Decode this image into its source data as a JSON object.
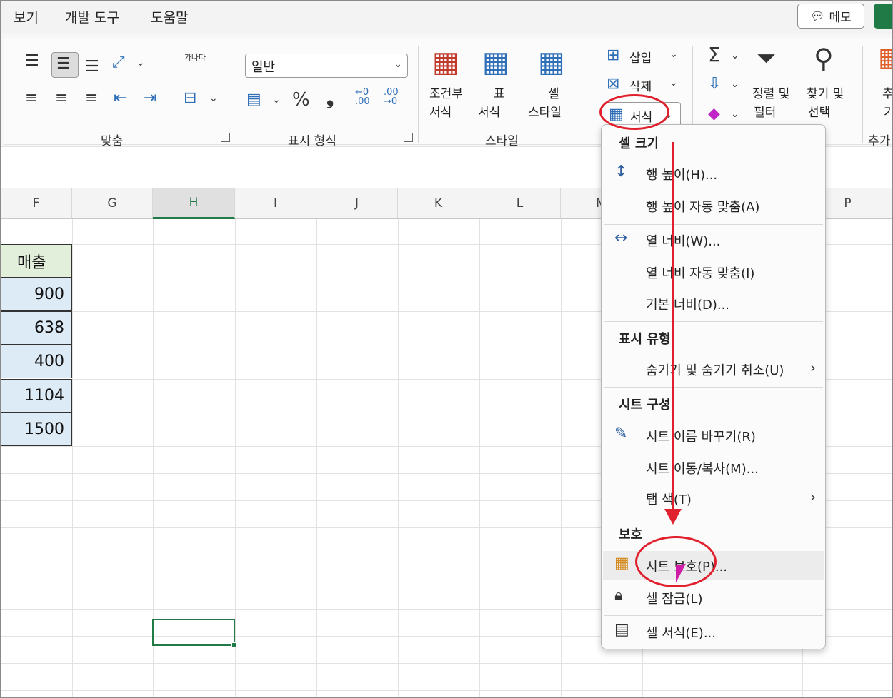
{
  "menubar": {
    "tabs": [
      "보기",
      "개발 도구",
      "도움말"
    ],
    "memo_label": "메모"
  },
  "ribbon": {
    "alignment_group": "맞춤",
    "number_group": "표시 형식",
    "style_group": "스타일",
    "extra_group": "추가",
    "wrap_text_icon_label": "가나다",
    "number_format_value": "일반",
    "percent_symbol": "%",
    "comma_symbol": "❟",
    "decimal_increase": "←0 .00",
    "decimal_decrease": ".00 →0",
    "conditional_format": [
      "조건부",
      "서식"
    ],
    "format_as_table": [
      "표",
      "서식"
    ],
    "cell_styles": [
      "셀",
      "스타일"
    ],
    "insert_label": "삽입",
    "delete_label": "삭제",
    "format_label": "서식",
    "sort_filter": [
      "정렬 및",
      "필터"
    ],
    "find_select": [
      "찾기 및",
      "선택"
    ],
    "extra_partial": [
      "추",
      "기"
    ]
  },
  "grid": {
    "columns": [
      "F",
      "G",
      "H",
      "I",
      "J",
      "K",
      "L",
      "M",
      "",
      "P"
    ],
    "active_column": "H",
    "header_cell": "매출",
    "values": [
      "900",
      "638",
      "400",
      "1104",
      "1500"
    ]
  },
  "dropdown": {
    "sections": {
      "cell_size": "셀 크기",
      "visibility": "표시 유형",
      "organize": "시트 구성",
      "protection": "보호"
    },
    "items": {
      "row_height": "행 높이(H)...",
      "autofit_row": "행 높이 자동 맞춤(A)",
      "col_width": "열 너비(W)...",
      "autofit_col": "열 너비 자동 맞춤(I)",
      "default_width": "기본 너비(D)...",
      "hide_unhide": "숨기기 및 숨기기 취소(U)",
      "rename_sheet": "시트 이름 바꾸기(R)",
      "move_copy": "시트 이동/복사(M)...",
      "tab_color": "탭 색(T)",
      "protect_sheet": "시트 보호(P)...",
      "lock_cell": "셀 잠금(L)",
      "format_cells": "셀 서식(E)..."
    }
  },
  "colors": {
    "excel_green": "#1f7a45",
    "annotation_red": "#e0202c",
    "cursor_magenta": "#d01ba6",
    "header_fill": "#e2efda",
    "value_fill": "#ddebf7"
  }
}
